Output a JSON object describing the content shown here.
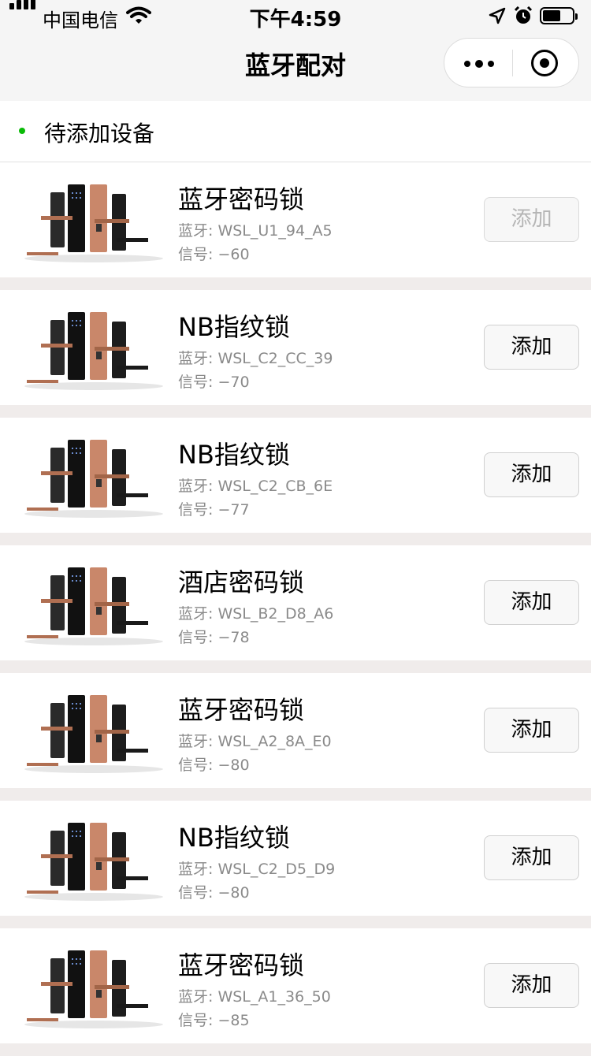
{
  "status_bar": {
    "carrier": "中国电信",
    "time": "下午4:59"
  },
  "nav": {
    "title": "蓝牙配对"
  },
  "section": {
    "title": "待添加设备",
    "bullet_color": "#09bb07"
  },
  "devices": [
    {
      "name": "蓝牙密码锁",
      "mac": "蓝牙: WSL_U1_94_A5",
      "rssi": "信号: −60",
      "button": "添加",
      "enabled": false
    },
    {
      "name": "NB指纹锁",
      "mac": "蓝牙: WSL_C2_CC_39",
      "rssi": "信号: −70",
      "button": "添加",
      "enabled": true
    },
    {
      "name": "NB指纹锁",
      "mac": "蓝牙: WSL_C2_CB_6E",
      "rssi": "信号: −77",
      "button": "添加",
      "enabled": true
    },
    {
      "name": "酒店密码锁",
      "mac": "蓝牙: WSL_B2_D8_A6",
      "rssi": "信号: −78",
      "button": "添加",
      "enabled": true
    },
    {
      "name": "蓝牙密码锁",
      "mac": "蓝牙: WSL_A2_8A_E0",
      "rssi": "信号: −80",
      "button": "添加",
      "enabled": true
    },
    {
      "name": "NB指纹锁",
      "mac": "蓝牙: WSL_C2_D5_D9",
      "rssi": "信号: −80",
      "button": "添加",
      "enabled": true
    },
    {
      "name": "蓝牙密码锁",
      "mac": "蓝牙: WSL_A1_36_50",
      "rssi": "信号: −85",
      "button": "添加",
      "enabled": true
    }
  ]
}
